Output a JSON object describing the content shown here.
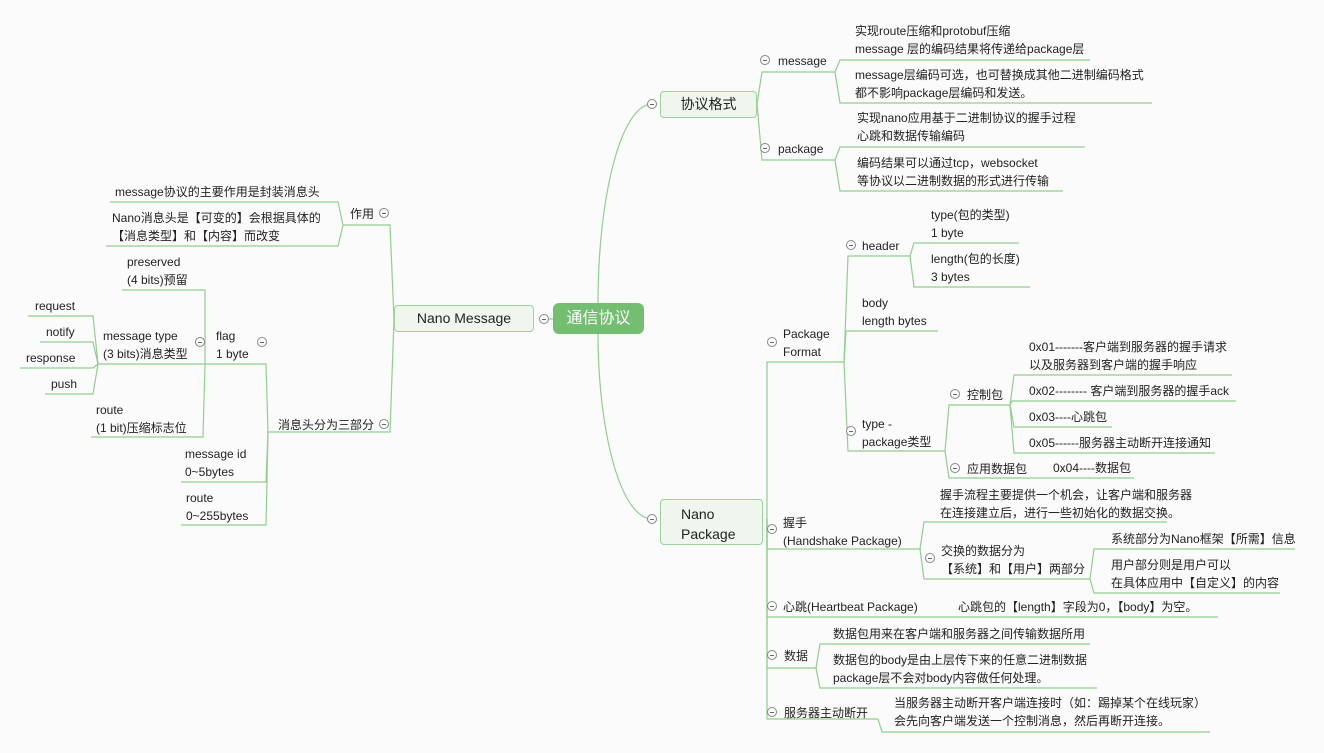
{
  "root": {
    "label": "通信协议"
  },
  "branches": {
    "protocol_format": {
      "label": "协议格式",
      "message": {
        "label": "message",
        "notes": [
          [
            "实现route压缩和protobuf压缩",
            "message 层的编码结果将传递给package层"
          ],
          [
            "message层编码可选，也可替换成其他二进制编码格式",
            "都不影响package层编码和发送。"
          ]
        ]
      },
      "package": {
        "label": "package",
        "notes": [
          [
            "实现nano应用基于二进制协议的握手过程",
            "心跳和数据传输编码"
          ],
          [
            "编码结果可以通过tcp，websocket",
            "等协议以二进制数据的形式进行传输"
          ]
        ]
      }
    },
    "nano_message": {
      "label": "Nano Message",
      "purpose": {
        "label": "作用",
        "notes": [
          [
            "message协议的主要作用是封装消息头"
          ],
          [
            "Nano消息头是【可变的】会根据具体的",
            "【消息类型】和【内容】而改变"
          ]
        ]
      },
      "header_parts": {
        "label": "消息头分为三部分",
        "flag": {
          "label": [
            "flag",
            "1 byte"
          ],
          "preserved": [
            "preserved",
            "(4 bits)预留"
          ],
          "message_type": {
            "label": [
              "message type",
              "(3 bits)消息类型"
            ],
            "types": [
              "request",
              "notify",
              "response",
              "push"
            ]
          },
          "route": [
            "route",
            "(1 bit)压缩标志位"
          ]
        },
        "message_id": [
          "message id",
          "0~5bytes"
        ],
        "route": [
          "route",
          "0~255bytes"
        ]
      }
    },
    "nano_package": {
      "label": [
        "Nano",
        "Package"
      ],
      "package_format": {
        "label": [
          "Package",
          "Format"
        ],
        "header": {
          "label": "header",
          "type": [
            "type(包的类型)",
            "1 byte"
          ],
          "length": [
            "length(包的长度)",
            "3 bytes"
          ]
        },
        "body": [
          "body",
          "length bytes"
        ],
        "type": {
          "label": [
            "type -",
            "package类型"
          ],
          "control": {
            "label": "控制包",
            "items": [
              [
                "0x01-------客户端到服务器的握手请求",
                "以及服务器到客户端的握手响应"
              ],
              [
                "0x02-------- 客户端到服务器的握手ack"
              ],
              [
                "0x03----心跳包"
              ],
              [
                "0x05------服务器主动断开连接通知"
              ]
            ]
          },
          "app_data": {
            "label": "应用数据包",
            "value": "0x04----数据包"
          }
        }
      },
      "handshake": {
        "label": [
          "握手",
          "(Handshake Package)"
        ],
        "note": [
          "握手流程主要提供一个机会，让客户端和服务器",
          "在连接建立后，进行一些初始化的数据交换。"
        ],
        "exchange": {
          "label": [
            "交换的数据分为",
            "【系统】和【用户】两部分"
          ],
          "system": [
            "系统部分为Nano框架【所需】信息"
          ],
          "user": [
            "用户部分则是用户可以",
            "在具体应用中【自定义】的内容"
          ]
        }
      },
      "heartbeat": {
        "label": "心跳(Heartbeat Package)",
        "note": "心跳包的【length】字段为0，【body】为空。"
      },
      "data": {
        "label": "数据",
        "notes": [
          [
            "数据包用来在客户端和服务器之间传输数据所用"
          ],
          [
            "数据包的body是由上层传下来的任意二进制数据",
            "package层不会对body内容做任何处理。"
          ]
        ]
      },
      "disconnect": {
        "label": "服务器主动断开",
        "note": [
          "当服务器主动断开客户端连接时（如：踢掉某个在线玩家）",
          "会先向客户端发送一个控制消息，然后再断开连接。"
        ]
      }
    }
  },
  "colors": {
    "root_fill": "#74be72",
    "branch_line": "#8fd08c",
    "node_fill": "#eff6ee"
  }
}
